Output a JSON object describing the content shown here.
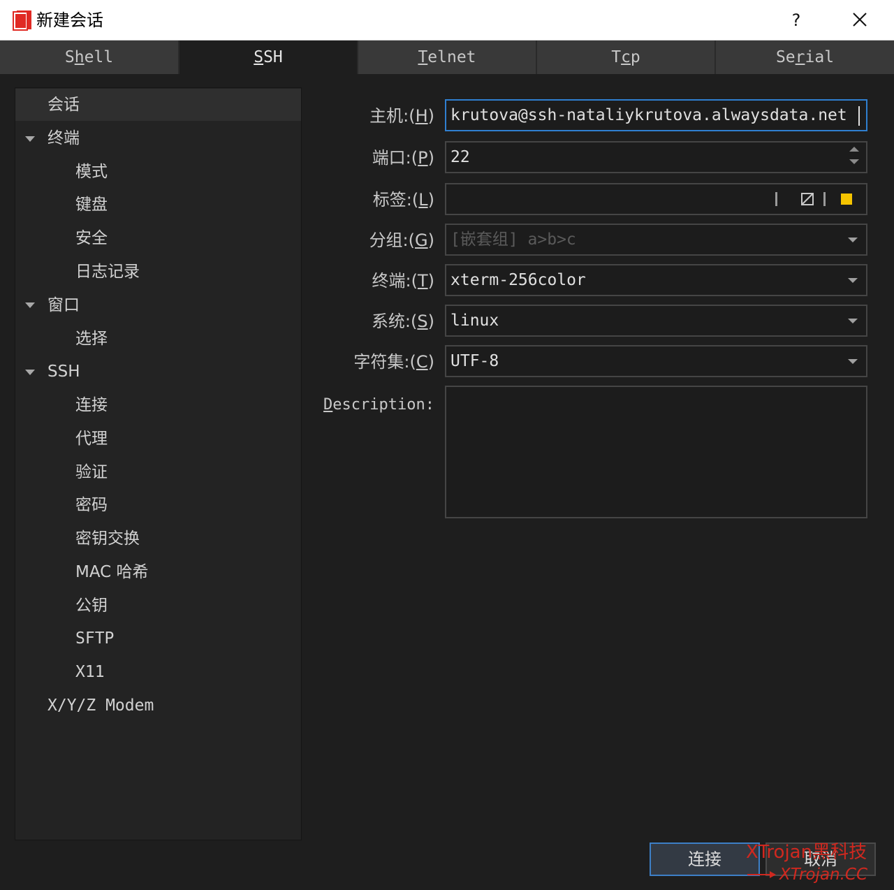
{
  "window": {
    "title": "新建会话",
    "help_label": "?"
  },
  "tabs": [
    {
      "pre": "S",
      "u": "h",
      "post": "ell",
      "active": false
    },
    {
      "pre": "",
      "u": "S",
      "post": "SH",
      "active": true
    },
    {
      "pre": "",
      "u": "T",
      "post": "elnet",
      "active": false
    },
    {
      "pre": "T",
      "u": "c",
      "post": "p",
      "active": false
    },
    {
      "pre": "Se",
      "u": "r",
      "post": "ial",
      "active": false
    }
  ],
  "nav": {
    "items": [
      {
        "label": "会话",
        "level": 0,
        "expandable": false,
        "selected": true
      },
      {
        "label": "终端",
        "level": 0,
        "expandable": true
      },
      {
        "label": "模式",
        "level": 1
      },
      {
        "label": "键盘",
        "level": 1
      },
      {
        "label": "安全",
        "level": 1
      },
      {
        "label": "日志记录",
        "level": 1
      },
      {
        "label": "窗口",
        "level": 0,
        "expandable": true
      },
      {
        "label": "选择",
        "level": 1
      },
      {
        "label": "SSH",
        "level": 0,
        "expandable": true
      },
      {
        "label": "连接",
        "level": 1
      },
      {
        "label": "代理",
        "level": 1
      },
      {
        "label": "验证",
        "level": 1
      },
      {
        "label": "密码",
        "level": 1
      },
      {
        "label": "密钥交换",
        "level": 1
      },
      {
        "label": "MAC 哈希",
        "level": 1
      },
      {
        "label": "公钥",
        "level": 1
      },
      {
        "label": "SFTP",
        "level": 1
      },
      {
        "label": "X11",
        "level": 1
      },
      {
        "label": "X/Y/Z Modem",
        "level": 0,
        "expandable": false
      }
    ]
  },
  "form": {
    "host": {
      "label_pre": "主机:(",
      "label_key": "H",
      "label_post": ")",
      "value": "krutova@ssh-nataliykrutova.alwaysdata.net"
    },
    "port": {
      "label_pre": "端口:(",
      "label_key": "P",
      "label_post": ")",
      "value": "22"
    },
    "tag": {
      "label_pre": "标签:(",
      "label_key": "L",
      "label_post": ")",
      "value": "",
      "tag_color": "#f5c400"
    },
    "group": {
      "label_pre": "分组:(",
      "label_key": "G",
      "label_post": ")",
      "placeholder": "[嵌套组] a>b>c"
    },
    "terminal": {
      "label_pre": "终端:(",
      "label_key": "T",
      "label_post": ")",
      "value": "xterm-256color"
    },
    "system": {
      "label_pre": "系统:(",
      "label_key": "S",
      "label_post": ")",
      "value": "linux"
    },
    "charset": {
      "label_pre": "字符集:(",
      "label_key": "C",
      "label_post": ")",
      "value": "UTF-8"
    },
    "description": {
      "label_key": "D",
      "label_post": "escription:",
      "value": ""
    }
  },
  "buttons": {
    "connect": "连接",
    "cancel": "取消"
  },
  "watermark": {
    "line1": "XTrojan黑科技",
    "line2": "XTrojan.CC"
  },
  "colors": {
    "accent": "#2f7fd0",
    "app_icon": "#e02a24",
    "watermark": "#d0281f"
  }
}
